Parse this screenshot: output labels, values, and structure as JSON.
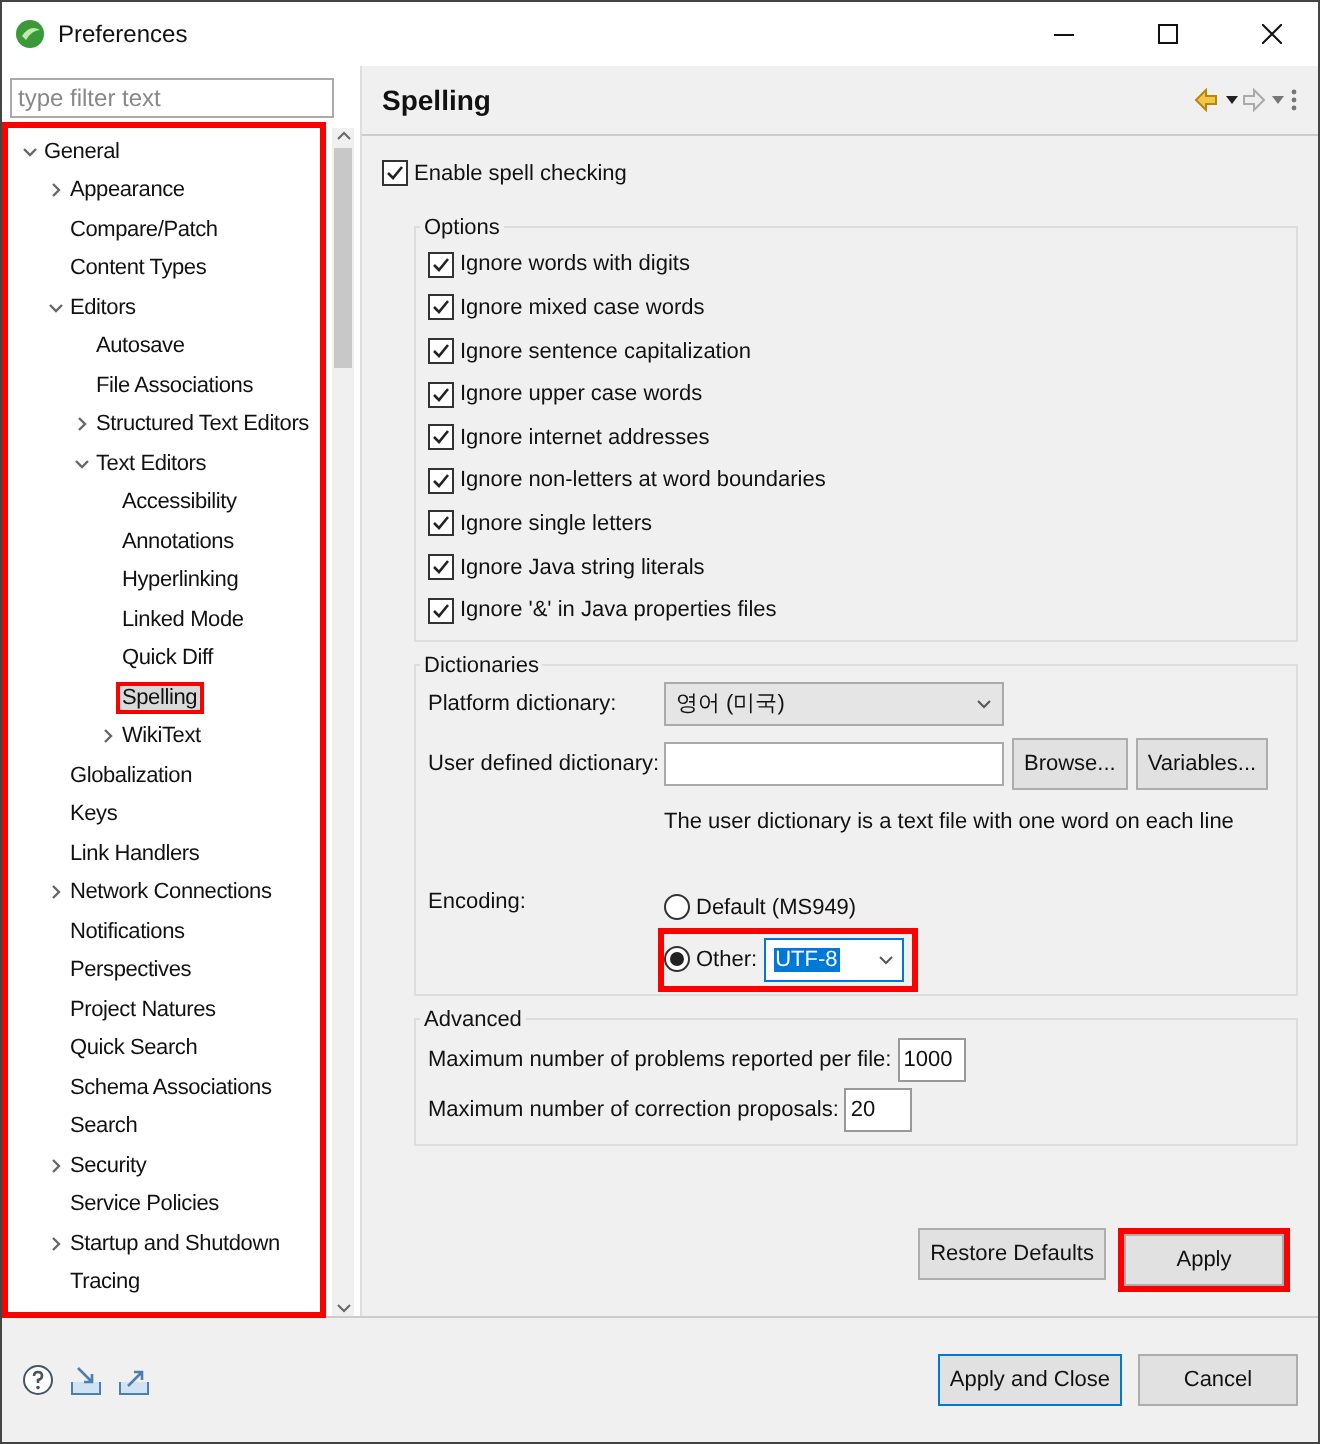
{
  "window": {
    "title": "Preferences"
  },
  "filter": {
    "placeholder": "type filter text"
  },
  "tree": {
    "highlighted": true,
    "items": [
      {
        "label": "General",
        "expanded": true,
        "selected": false,
        "highlighted": false,
        "children": [
          {
            "label": "Appearance",
            "expanded": false,
            "selected": false,
            "highlighted": false
          },
          {
            "label": "Compare/Patch",
            "selected": false,
            "highlighted": false
          },
          {
            "label": "Content Types",
            "selected": false,
            "highlighted": false
          },
          {
            "label": "Editors",
            "expanded": true,
            "selected": false,
            "highlighted": false,
            "children": [
              {
                "label": "Autosave",
                "selected": false,
                "highlighted": false
              },
              {
                "label": "File Associations",
                "selected": false,
                "highlighted": false
              },
              {
                "label": "Structured Text Editors",
                "expanded": false,
                "selected": false,
                "highlighted": false
              },
              {
                "label": "Text Editors",
                "expanded": true,
                "selected": false,
                "highlighted": false,
                "children": [
                  {
                    "label": "Accessibility",
                    "selected": false,
                    "highlighted": false
                  },
                  {
                    "label": "Annotations",
                    "selected": false,
                    "highlighted": false
                  },
                  {
                    "label": "Hyperlinking",
                    "selected": false,
                    "highlighted": false
                  },
                  {
                    "label": "Linked Mode",
                    "selected": false,
                    "highlighted": false
                  },
                  {
                    "label": "Quick Diff",
                    "selected": false,
                    "highlighted": false
                  },
                  {
                    "label": "Spelling",
                    "selected": true,
                    "highlighted": true
                  },
                  {
                    "label": "WikiText",
                    "expanded": false,
                    "selected": false,
                    "highlighted": false
                  }
                ]
              }
            ]
          },
          {
            "label": "Globalization",
            "selected": false,
            "highlighted": false
          },
          {
            "label": "Keys",
            "selected": false,
            "highlighted": false
          },
          {
            "label": "Link Handlers",
            "selected": false,
            "highlighted": false
          },
          {
            "label": "Network Connections",
            "expanded": false,
            "selected": false,
            "highlighted": false
          },
          {
            "label": "Notifications",
            "selected": false,
            "highlighted": false
          },
          {
            "label": "Perspectives",
            "selected": false,
            "highlighted": false
          },
          {
            "label": "Project Natures",
            "selected": false,
            "highlighted": false
          },
          {
            "label": "Quick Search",
            "selected": false,
            "highlighted": false
          },
          {
            "label": "Schema Associations",
            "selected": false,
            "highlighted": false
          },
          {
            "label": "Search",
            "selected": false,
            "highlighted": false
          },
          {
            "label": "Security",
            "expanded": false,
            "selected": false,
            "highlighted": false
          },
          {
            "label": "Service Policies",
            "selected": false,
            "highlighted": false
          },
          {
            "label": "Startup and Shutdown",
            "expanded": false,
            "selected": false,
            "highlighted": false
          },
          {
            "label": "Tracing",
            "selected": false,
            "highlighted": false
          }
        ]
      }
    ]
  },
  "page": {
    "title": "Spelling",
    "enable": {
      "label": "Enable spell checking",
      "checked": true
    },
    "options": {
      "title": "Options",
      "items": [
        {
          "label": "Ignore words with digits",
          "checked": true
        },
        {
          "label": "Ignore mixed case words",
          "checked": true
        },
        {
          "label": "Ignore sentence capitalization",
          "checked": true
        },
        {
          "label": "Ignore upper case words",
          "checked": true
        },
        {
          "label": "Ignore internet addresses",
          "checked": true
        },
        {
          "label": "Ignore non-letters at word boundaries",
          "checked": true
        },
        {
          "label": "Ignore single letters",
          "checked": true
        },
        {
          "label": "Ignore Java string literals",
          "checked": true
        },
        {
          "label": "Ignore '&' in Java properties files",
          "checked": true
        }
      ]
    },
    "dictionaries": {
      "title": "Dictionaries",
      "platform_label": "Platform dictionary:",
      "platform_value": "영어 (미국)",
      "user_label": "User defined dictionary:",
      "browse": "Browse...",
      "variables": "Variables...",
      "hint": "The user dictionary is a text file with one word on each line",
      "encoding_label": "Encoding:",
      "encodings": [
        {
          "label": "Default (MS949)",
          "selected": false,
          "highlighted": false
        },
        {
          "label": "Other:",
          "selected": true,
          "highlighted": true,
          "value": "UTF-8"
        }
      ]
    },
    "advanced": {
      "title": "Advanced",
      "rows": [
        {
          "label": "Maximum number of problems reported per file:",
          "value": "1000"
        },
        {
          "label": "Maximum number of correction proposals:",
          "value": "20"
        }
      ]
    },
    "buttons": [
      {
        "label": "Restore Defaults",
        "highlighted": false
      },
      {
        "label": "Apply",
        "highlighted": true
      }
    ]
  },
  "footer": {
    "buttons": [
      {
        "label": "Apply and Close",
        "default": true
      },
      {
        "label": "Cancel",
        "default": false
      }
    ]
  }
}
